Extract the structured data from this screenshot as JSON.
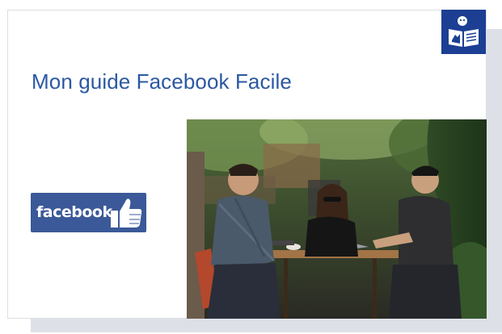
{
  "page": {
    "title": "Mon guide Facebook Facile"
  },
  "badge": {
    "icon": "easy-read-icon",
    "color": "#1c3f94"
  },
  "facebook_logo": {
    "text": "facebook",
    "icon": "thumbs-up-icon",
    "color": "#3b5998"
  },
  "photo": {
    "subject": "three people at a cafe table with a laptop"
  },
  "colors": {
    "title": "#2b58a3",
    "card_border": "#dcdfe4",
    "card_shadow": "#dde1e7"
  }
}
